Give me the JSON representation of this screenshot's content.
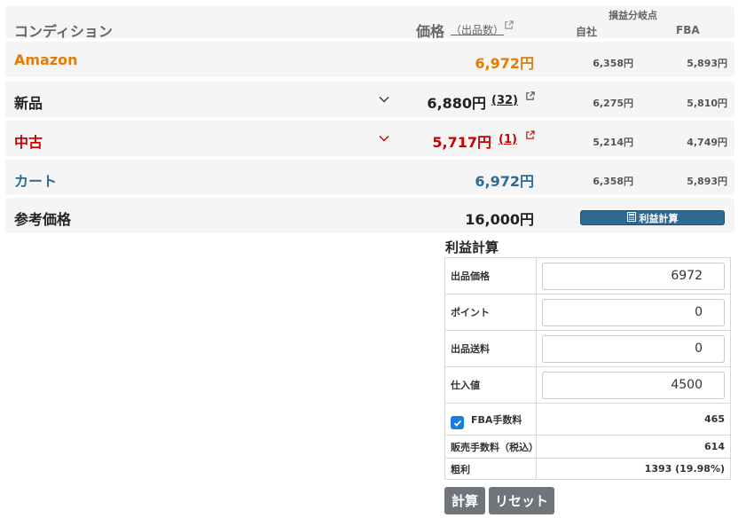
{
  "header": {
    "condition": "コンディション",
    "price": "価格",
    "count": "（出品数）",
    "breakeven": "損益分岐点",
    "jisha": "自社",
    "fba": "FBA"
  },
  "rows": [
    {
      "label": "Amazon",
      "price": "6,972円",
      "count": "",
      "be_jisha": "6,358円",
      "be_fba": "5,893円"
    },
    {
      "label": "新品",
      "price": "6,880円",
      "count": "(32)",
      "be_jisha": "6,275円",
      "be_fba": "5,810円"
    },
    {
      "label": "中古",
      "price": "5,717円",
      "count": "(1)",
      "be_jisha": "5,214円",
      "be_fba": "4,749円"
    },
    {
      "label": "カート",
      "price": "6,972円",
      "count": "",
      "be_jisha": "6,358円",
      "be_fba": "5,893円"
    },
    {
      "label": "参考価格",
      "price": "16,000円",
      "count": "",
      "be_jisha": "",
      "be_fba": ""
    }
  ],
  "calc_button": "利益計算",
  "calc": {
    "title": "利益計算",
    "listing_price_label": "出品価格",
    "listing_price": "6972",
    "point_label": "ポイント",
    "point": "0",
    "shipping_label": "出品送料",
    "shipping": "0",
    "cost_label": "仕入値",
    "cost": "4500",
    "fba_fee_label": "FBA手数料",
    "fba_fee": "465",
    "fba_checked": true,
    "sales_fee_label": "販売手数料（税込）",
    "sales_fee": "614",
    "profit_label": "粗利",
    "profit": "1393 (19.98%)"
  },
  "buttons": {
    "calc": "計算",
    "reset": "リセット"
  },
  "colors": {
    "amazon": "#e57c00",
    "used": "#cc0000",
    "cart": "#2e6b94",
    "button": "#6f757a"
  }
}
